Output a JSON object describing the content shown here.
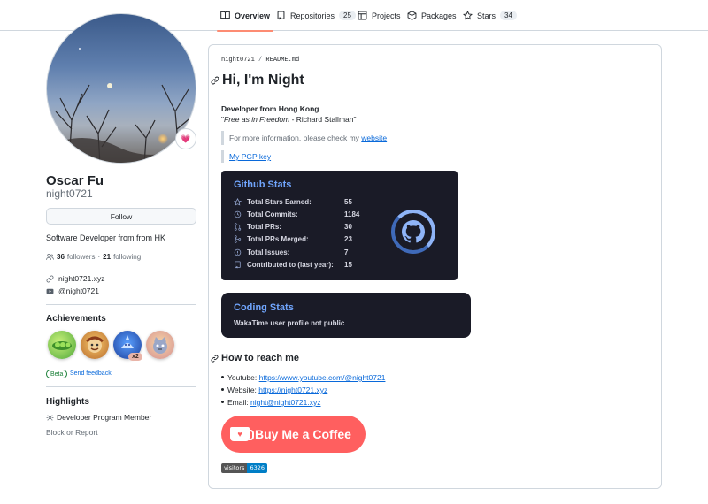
{
  "nav": {
    "tabs": [
      {
        "label": "Overview",
        "count": ""
      },
      {
        "label": "Repositories",
        "count": "25"
      },
      {
        "label": "Projects",
        "count": ""
      },
      {
        "label": "Packages",
        "count": ""
      },
      {
        "label": "Stars",
        "count": "34"
      }
    ]
  },
  "profile": {
    "status_emoji": "💗",
    "name": "Oscar Fu",
    "login": "night0721",
    "follow_label": "Follow",
    "bio": "Software Developer from from HK",
    "followers_count": "36",
    "followers_label": "followers",
    "dot": "·",
    "following_count": "21",
    "following_label": "following",
    "website": "night0721.xyz",
    "youtube": "@night0721"
  },
  "achievements": {
    "title": "Achievements",
    "badge_multiplier": "x2",
    "beta_label": "Beta",
    "feedback_label": "Send feedback"
  },
  "highlights": {
    "title": "Highlights",
    "item": "Developer Program Member",
    "block_label": "Block or Report"
  },
  "readme": {
    "path_user": "night0721",
    "path_sep": "/",
    "path_file": "README.md",
    "heading": "Hi, I'm Night",
    "developer_line": "Developer from Hong Kong",
    "quote_open": "\"",
    "quote_italic": "Free as in Freedom",
    "quote_rest": " - Richard Stallman\"",
    "info_prefix": "For more information, please check my ",
    "info_link": "website",
    "pgp_link": "My PGP key",
    "github_stats": {
      "title": "Github Stats",
      "rows": [
        {
          "label": "Total Stars Earned:",
          "value": "55"
        },
        {
          "label": "Total Commits:",
          "value": "1184"
        },
        {
          "label": "Total PRs:",
          "value": "30"
        },
        {
          "label": "Total PRs Merged:",
          "value": "23"
        },
        {
          "label": "Total Issues:",
          "value": "7"
        },
        {
          "label": "Contributed to (last year):",
          "value": "15"
        }
      ]
    },
    "coding_stats": {
      "title": "Coding Stats",
      "text": "WakaTime user profile not public"
    },
    "reach_heading": "How to reach me",
    "contacts": [
      {
        "label": "Youtube: ",
        "link": "https://www.youtube.com/@night0721"
      },
      {
        "label": "Website: ",
        "link": "https://night0721.xyz"
      },
      {
        "label": "Email: ",
        "link": "night@night0721.xyz"
      }
    ],
    "coffee_label": "Buy Me a Coffee",
    "visitors_label": "visitors",
    "visitors_count": "6326"
  },
  "colors": {
    "accent_tab": "#fd8c73",
    "link": "#0969da",
    "card_bg": "#1a1b27",
    "card_title": "#70a5fd",
    "coffee": "#ff5f5f"
  }
}
